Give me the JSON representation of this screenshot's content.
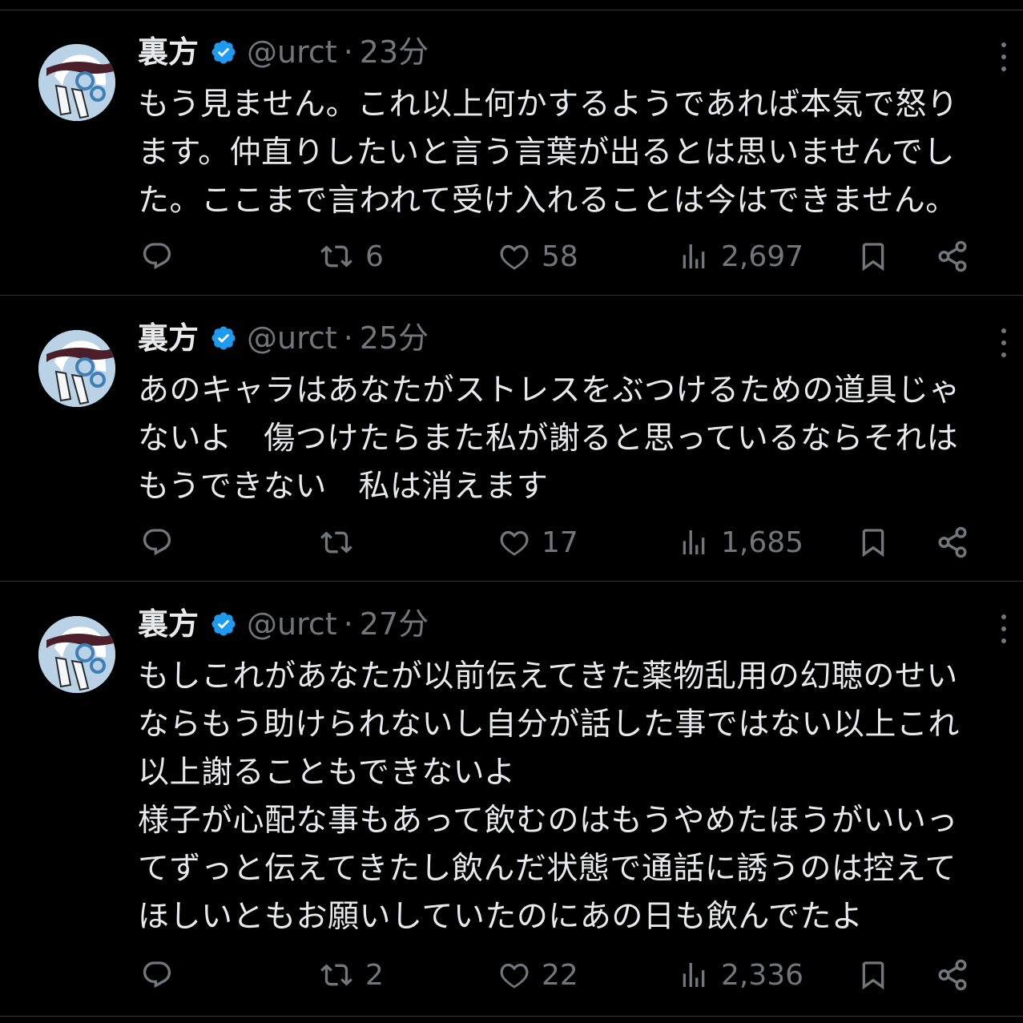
{
  "tweets": [
    {
      "name": "裏方",
      "handle": "@urct",
      "separator": "·",
      "time": "23分",
      "lines": [
        "もう見ません。これ以上何かするようであれば本気で怒り",
        "ます。仲直りしたいと言う言葉が出るとは思いませんでし",
        "た。ここまで言われて受け入れることは今はできません。"
      ],
      "retweets": "6",
      "likes": "58",
      "views": "2,697"
    },
    {
      "name": "裏方",
      "handle": "@urct",
      "separator": "·",
      "time": "25分",
      "lines": [
        "あのキャラはあなたがストレスをぶつけるための道具じゃ",
        "ないよ　傷つけたらまた私が謝ると思っているならそれは",
        "もうできない　私は消えます"
      ],
      "retweets": "",
      "likes": "17",
      "views": "1,685"
    },
    {
      "name": "裏方",
      "handle": "@urct",
      "separator": "·",
      "time": "27分",
      "lines": [
        "もしこれがあなたが以前伝えてきた薬物乱用の幻聴のせい",
        "ならもう助けられないし自分が話した事ではない以上これ",
        "以上謝ることもできないよ",
        "様子が心配な事もあって飲むのはもうやめたほうがいいっ",
        "てずっと伝えてきたし飲んだ状態で通話に誘うのは控えて",
        "ほしいともお願いしていたのにあの日も飲んでたよ"
      ],
      "retweets": "2",
      "likes": "22",
      "views": "2,336"
    }
  ],
  "colors": {
    "background": "#000000",
    "text": "#e7e9ea",
    "muted": "#71767b",
    "verified": "#1d9bf0",
    "divider": "#2f3336"
  },
  "icons": [
    "reply-icon",
    "retweet-icon",
    "like-icon",
    "views-icon",
    "bookmark-icon",
    "share-icon",
    "verified-badge-icon",
    "more-icon"
  ]
}
